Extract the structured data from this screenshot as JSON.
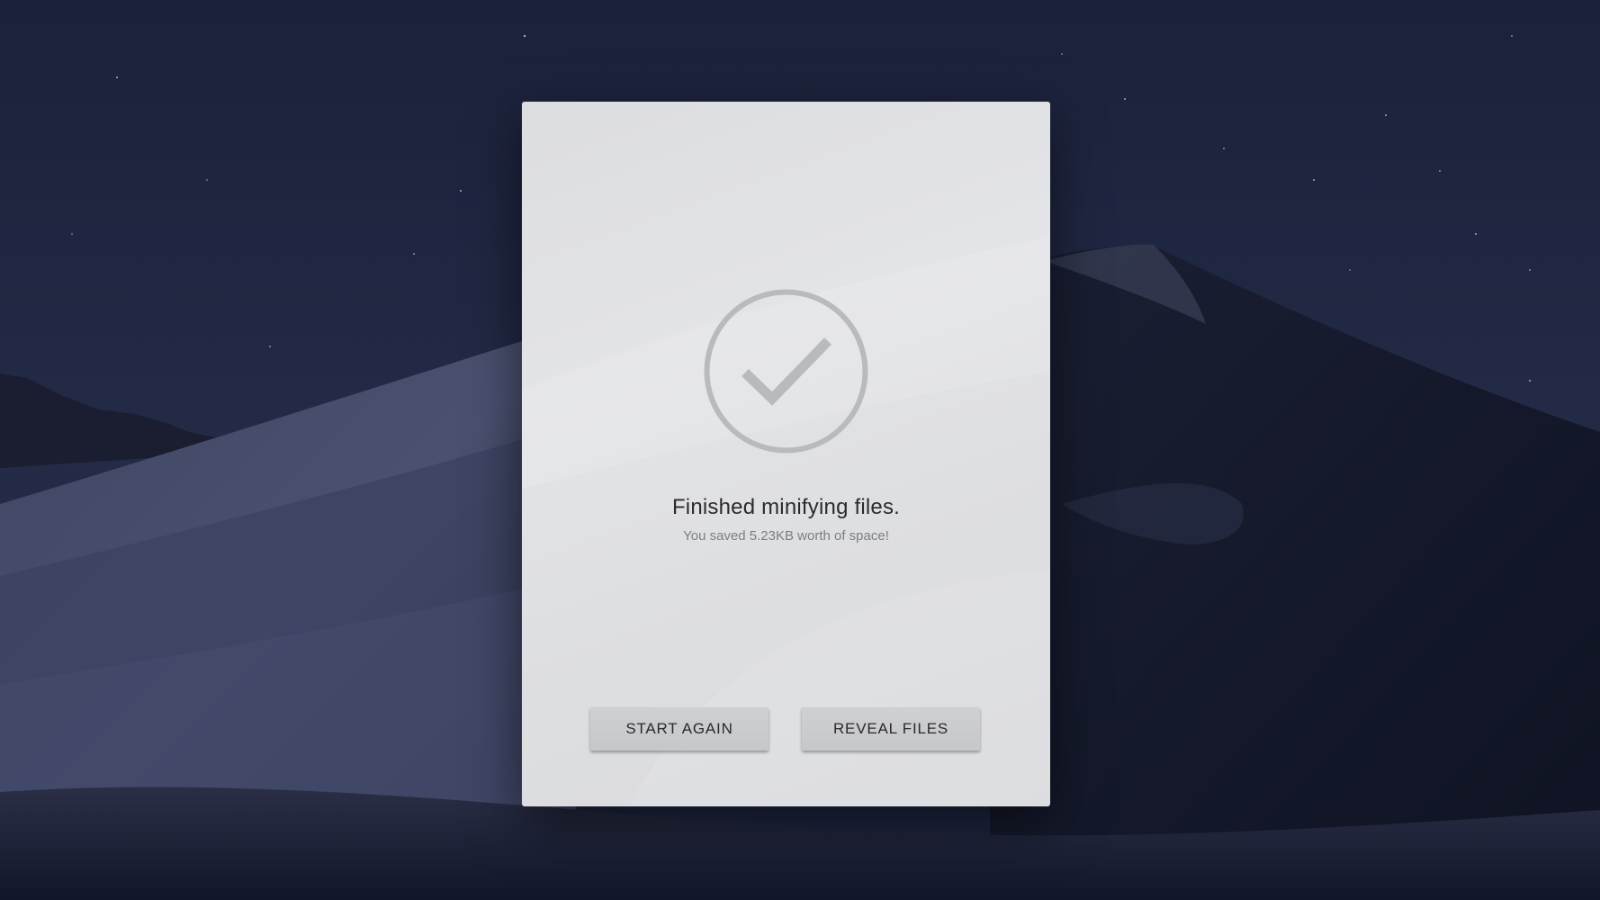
{
  "dialog": {
    "title": "Finished minifying files.",
    "subtitle": "You saved 5.23KB worth of space!",
    "icon": "check-circle-icon"
  },
  "buttons": {
    "start_again": "START AGAIN",
    "reveal_files": "REVEAL FILES"
  },
  "colors": {
    "dialog_background": "#e0e1e4",
    "icon_stroke": "#b9babd",
    "button_background": "#c9cacd",
    "desktop_background": "#1a2038"
  }
}
